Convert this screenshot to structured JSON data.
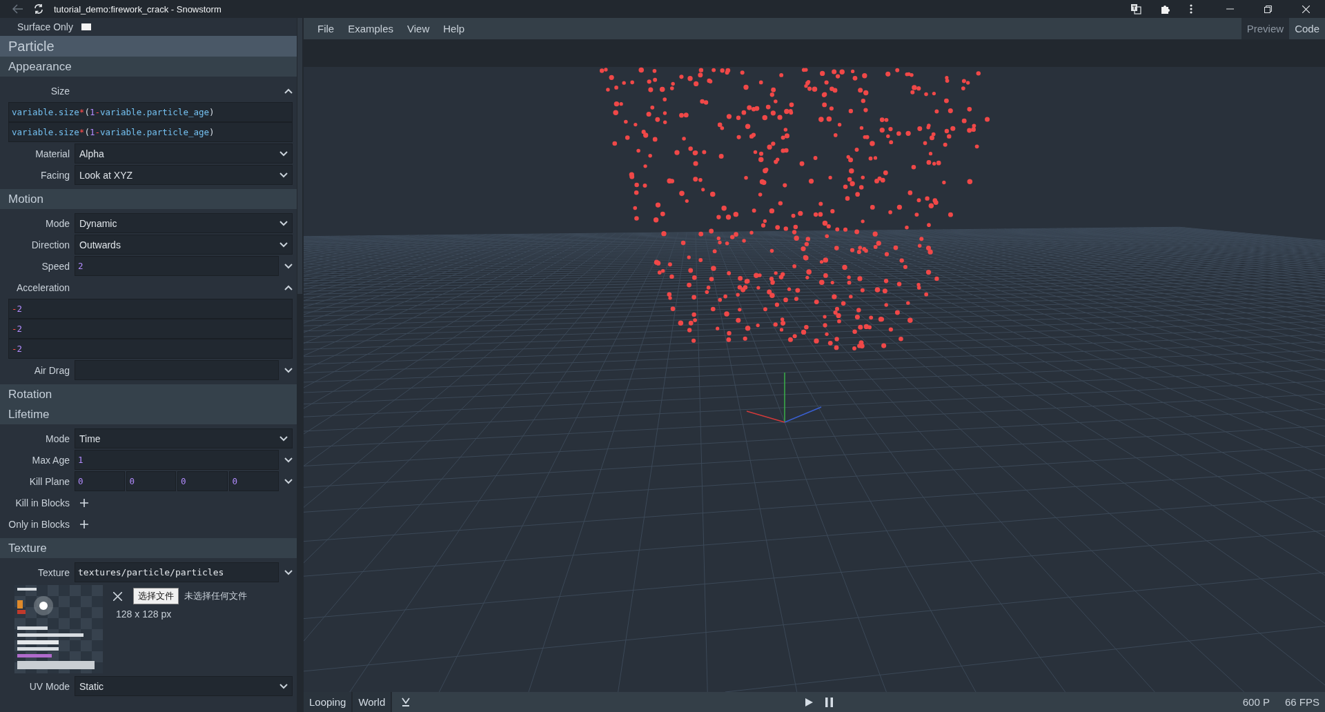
{
  "window": {
    "title": "tutorial_demo:firework_crack - Snowstorm"
  },
  "sidebar": {
    "top_row": {
      "label": "Surface Only",
      "checked": false
    },
    "panel_title": "Particle",
    "sections": [
      {
        "title": "Appearance",
        "rows": [
          {
            "kind": "molang",
            "label": "Size",
            "expanded": true,
            "values": [
              "variable.size*(1-variable.particle_age)",
              "variable.size*(1-variable.particle_age)"
            ]
          },
          {
            "kind": "select",
            "label": "Material",
            "value": "Alpha"
          },
          {
            "kind": "select",
            "label": "Facing",
            "value": "Look at XYZ"
          }
        ]
      },
      {
        "title": "Motion",
        "rows": [
          {
            "kind": "select",
            "label": "Mode",
            "value": "Dynamic"
          },
          {
            "kind": "select",
            "label": "Direction",
            "value": "Outwards"
          },
          {
            "kind": "molang",
            "label": "Speed",
            "expanded": false,
            "values": [
              "2"
            ]
          },
          {
            "kind": "molang",
            "label": "Acceleration",
            "expanded": true,
            "values": [
              "-2",
              "-2",
              "-2"
            ]
          },
          {
            "kind": "molang",
            "label": "Air Drag",
            "expanded": false
          }
        ]
      },
      {
        "title": "Rotation"
      },
      {
        "title": "Lifetime",
        "rows": [
          {
            "kind": "select",
            "label": "Mode",
            "value": "Time"
          },
          {
            "kind": "molang",
            "label": "Max Age",
            "expanded": false,
            "values": [
              "1"
            ]
          },
          {
            "kind": "molang",
            "label": "Kill Plane",
            "expanded": false,
            "values": [
              "0",
              "0",
              "0",
              "0"
            ]
          },
          {
            "kind": "add",
            "label": "Kill in Blocks"
          },
          {
            "kind": "add",
            "label": "Only in Blocks"
          }
        ]
      },
      {
        "title": "Texture",
        "rows": [
          {
            "kind": "text",
            "label": "Texture",
            "expanded": false,
            "value": "textures/particle/particles"
          },
          {
            "kind": "texture_preview",
            "button": "选择文件",
            "file_status": "未选择任何文件",
            "size": "128 x 128 px"
          },
          {
            "kind": "select",
            "label": "UV Mode",
            "value": "Static"
          }
        ]
      }
    ]
  },
  "menu": [
    "File",
    "Examples",
    "View",
    "Help"
  ],
  "view_tabs": [
    {
      "label": "Preview",
      "selected": true
    },
    {
      "label": "Code",
      "selected": false
    }
  ],
  "status_bar": {
    "toggles": [
      "Looping",
      "World"
    ],
    "particle_count": "600 P",
    "fps": "66 FPS"
  }
}
